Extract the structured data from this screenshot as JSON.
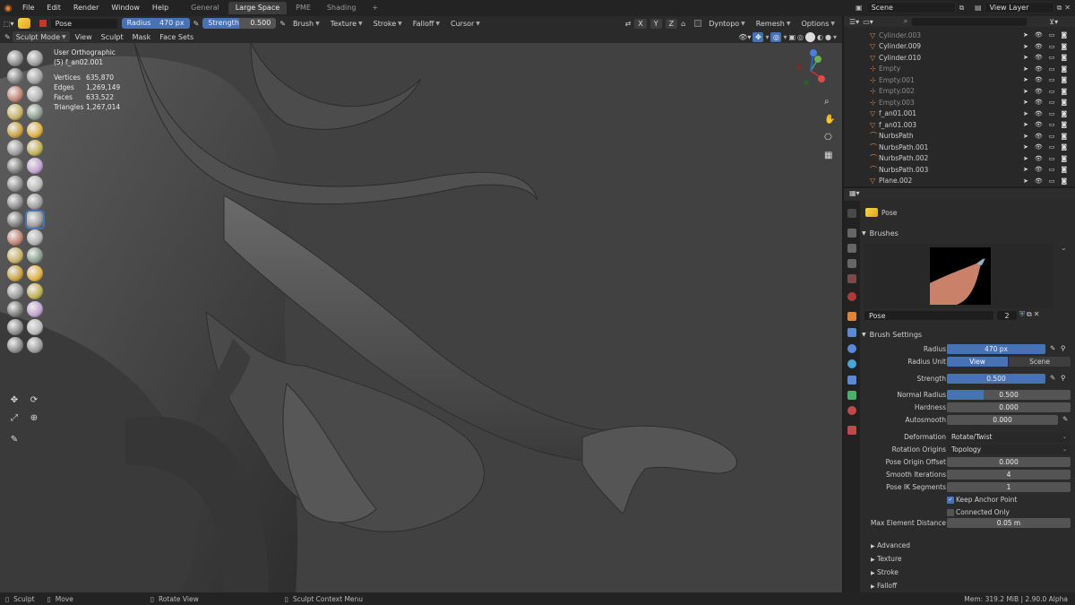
{
  "topbar": {
    "menus": [
      "File",
      "Edit",
      "Render",
      "Window",
      "Help"
    ],
    "workspaces": [
      {
        "label": "General",
        "active": false
      },
      {
        "label": "Large Space",
        "active": true
      },
      {
        "label": "PME",
        "active": false
      },
      {
        "label": "Shading",
        "active": false
      }
    ],
    "add_tab": "+",
    "scene": "Scene",
    "view_layer": "View Layer"
  },
  "tool_header": {
    "brush_name": "Pose",
    "radius_label": "Radius",
    "radius_value": "470 px",
    "strength_label": "Strength",
    "strength_value": "0.500",
    "strength_fraction": 0.5,
    "menus": [
      "Brush",
      "Texture",
      "Stroke",
      "Falloff",
      "Cursor"
    ],
    "axis_x": "X",
    "axis_y": "Y",
    "axis_z": "Z",
    "dyntopo": "Dyntopo",
    "remesh": "Remesh",
    "options": "Options"
  },
  "view_header": {
    "mode": "Sculpt Mode",
    "menus": [
      "View",
      "Sculpt",
      "Mask",
      "Face Sets"
    ]
  },
  "overlay": {
    "view_name": "User Orthographic",
    "object": "(5) f_an02.001",
    "stats": [
      {
        "k": "Vertices",
        "v": "635,870"
      },
      {
        "k": "Edges",
        "v": "1,269,149"
      },
      {
        "k": "Faces",
        "v": "633,522"
      },
      {
        "k": "Triangles",
        "v": "1,267,014"
      }
    ]
  },
  "outliner": {
    "search_placeholder": "",
    "items": [
      {
        "name": "Cylinder.003",
        "faded": true
      },
      {
        "name": "Cylinder.009",
        "faded": false
      },
      {
        "name": "Cylinder.010",
        "faded": false
      },
      {
        "name": "Empty",
        "faded": true
      },
      {
        "name": "Empty.001",
        "faded": true
      },
      {
        "name": "Empty.002",
        "faded": true
      },
      {
        "name": "Empty.003",
        "faded": true
      },
      {
        "name": "f_an01.001",
        "faded": false
      },
      {
        "name": "f_an01.003",
        "faded": false
      },
      {
        "name": "NurbsPath",
        "faded": false
      },
      {
        "name": "NurbsPath.001",
        "faded": false
      },
      {
        "name": "NurbsPath.002",
        "faded": false
      },
      {
        "name": "NurbsPath.003",
        "faded": false
      },
      {
        "name": "Plane.002",
        "faded": false
      }
    ]
  },
  "properties": {
    "tool_name": "Pose",
    "brushes_header": "Brushes",
    "brush_field": "Pose",
    "brush_users": "2",
    "brush_settings_header": "Brush Settings",
    "radius_label": "Radius",
    "radius_value": "470 px",
    "radius_unit_label": "Radius Unit",
    "radius_unit_view": "View",
    "radius_unit_scene": "Scene",
    "strength_label": "Strength",
    "strength_value": "0.500",
    "normal_radius_label": "Normal Radius",
    "normal_radius_value": "0.500",
    "normal_radius_fraction": 0.3,
    "hardness_label": "Hardness",
    "hardness_value": "0.000",
    "autosmooth_label": "Autosmooth",
    "autosmooth_value": "0.000",
    "deformation_label": "Deformation",
    "deformation_value": "Rotate/Twist",
    "rotation_origins_label": "Rotation Origins",
    "rotation_origins_value": "Topology",
    "pose_origin_offset_label": "Pose Origin Offset",
    "pose_origin_offset_value": "0.000",
    "smooth_iterations_label": "Smooth Iterations",
    "smooth_iterations_value": "4",
    "pose_ik_segments_label": "Pose IK Segments",
    "pose_ik_segments_value": "1",
    "keep_anchor_label": "Keep Anchor Point",
    "keep_anchor_checked": true,
    "connected_only_label": "Connected Only",
    "connected_only_checked": false,
    "max_element_label": "Max Element Distance",
    "max_element_value": "0.05 m",
    "subpanels": [
      "Advanced",
      "Texture",
      "Stroke",
      "Falloff"
    ]
  },
  "statusbar": {
    "left1": "Sculpt",
    "left2": "Move",
    "mid1": "Rotate View",
    "mid2": "Sculpt Context Menu",
    "right": "Mem: 319.2 MiB | 2.90.0 Alpha"
  },
  "colors": {
    "accent": "#4772b3",
    "viewport": "#414141",
    "panel": "#2b2b2b"
  }
}
